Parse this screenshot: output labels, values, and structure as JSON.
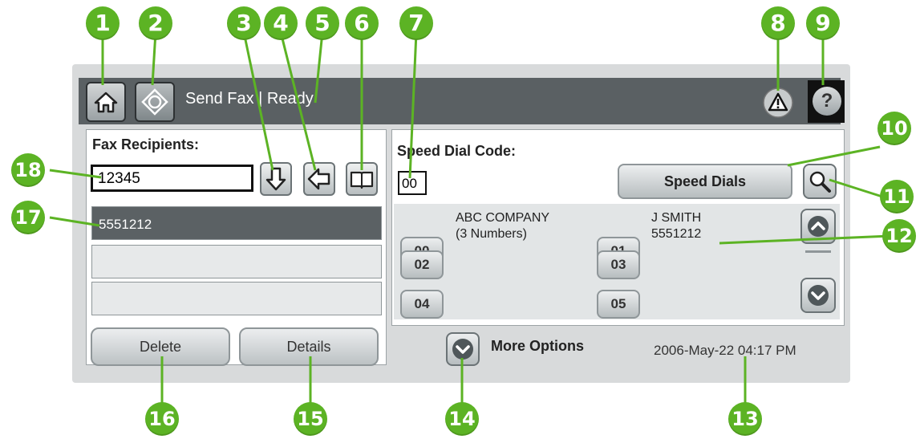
{
  "callouts": [
    "1",
    "2",
    "3",
    "4",
    "5",
    "6",
    "7",
    "8",
    "9",
    "10",
    "11",
    "12",
    "13",
    "14",
    "15",
    "16",
    "17",
    "18"
  ],
  "titlebar": {
    "title": "Send Fax | Ready",
    "help_glyph": "?"
  },
  "recipients": {
    "label": "Fax Recipients:",
    "input_value": "12345",
    "rows": [
      "5551212",
      "",
      ""
    ]
  },
  "buttons": {
    "delete": "Delete",
    "details": "Details"
  },
  "speed_dial": {
    "label": "Speed Dial Code:",
    "code_value": "00",
    "button_label": "Speed Dials",
    "entries": [
      {
        "code": "00",
        "name": "ABC COMPANY",
        "detail": "(3 Numbers)"
      },
      {
        "code": "01",
        "name": "J SMITH",
        "detail": "5551212"
      },
      {
        "code": "02",
        "name": "",
        "detail": ""
      },
      {
        "code": "03",
        "name": "",
        "detail": ""
      },
      {
        "code": "04",
        "name": "",
        "detail": ""
      },
      {
        "code": "05",
        "name": "",
        "detail": ""
      }
    ]
  },
  "footer": {
    "more_options": "More Options",
    "datetime": "2006-May-22  04:17 PM"
  },
  "colors": {
    "callout": "#5cb324",
    "titlebar": "#5a6063",
    "selected_row": "#5b6164"
  },
  "icons": [
    "home-icon",
    "start-icon",
    "arrow-down-icon",
    "backspace-icon",
    "phonebook-icon",
    "warning-icon",
    "help-icon",
    "search-icon",
    "chevron-up-icon",
    "chevron-down-icon"
  ]
}
